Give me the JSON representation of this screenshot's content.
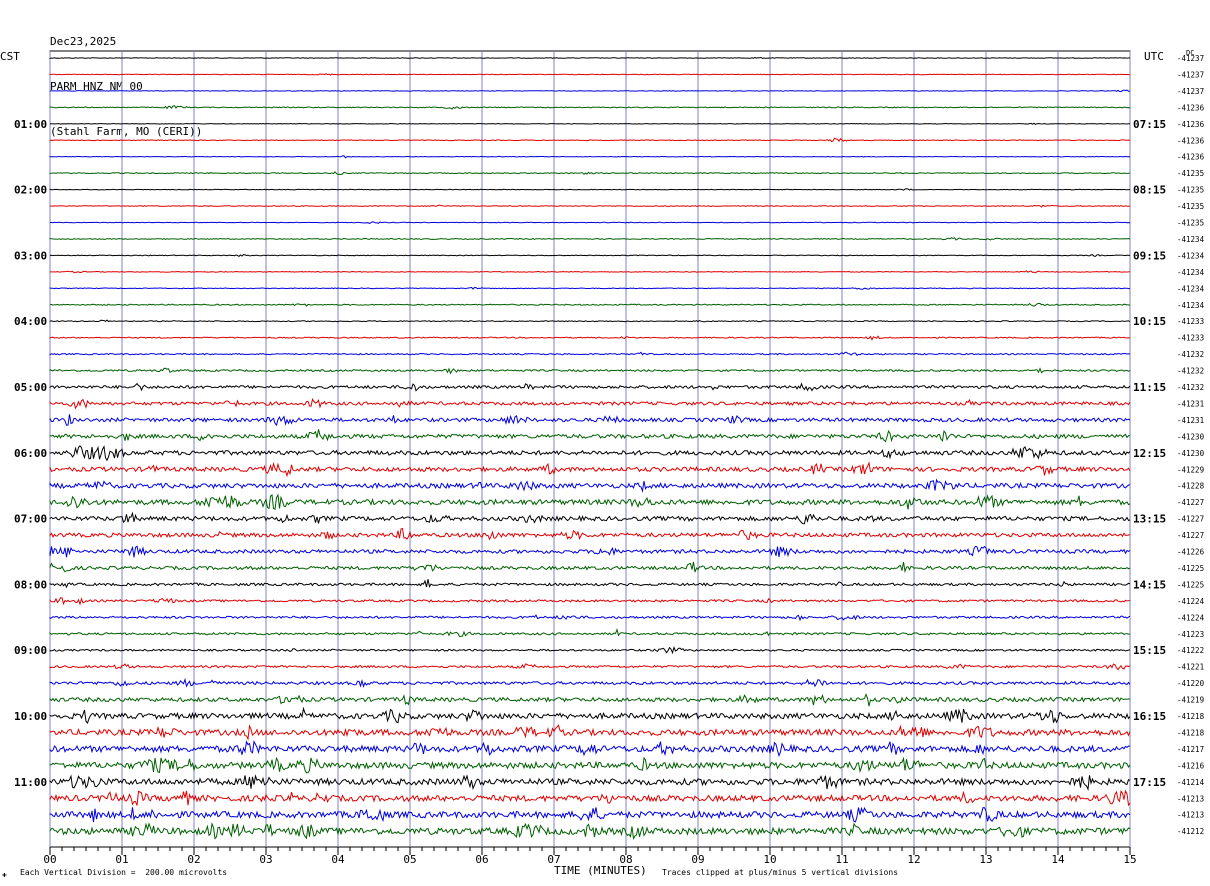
{
  "header": {
    "date": "Dec23,2025",
    "station": "PARM HNZ NM 00",
    "location": "(Stahl Farm, MO (CERI))"
  },
  "left_tz": "CST",
  "right_tz": "UTC",
  "dc_label": "DC",
  "footer": {
    "scale_note": "Each Vertical Division =  200.00 microvolts",
    "clip_note": "Traces clipped at plus/minus 5 vertical divisions",
    "mark": "✚"
  },
  "colors": {
    "trace_cycle": [
      "#000000",
      "#e00000",
      "#0000e0",
      "#006000"
    ],
    "grid": "#8080c0"
  },
  "chart_data": {
    "type": "line",
    "title": "PARM HNZ NM 00",
    "xlabel": "TIME (MINUTES)",
    "ylabel": "",
    "xlim": [
      0,
      15
    ],
    "x_ticks": [
      "00",
      "01",
      "02",
      "03",
      "04",
      "05",
      "06",
      "07",
      "08",
      "09",
      "10",
      "11",
      "12",
      "13",
      "14",
      "15"
    ],
    "left_time_labels": [
      "01:00",
      "02:00",
      "03:00",
      "04:00",
      "05:00",
      "06:00",
      "07:00",
      "08:00",
      "09:00",
      "10:00",
      "11:00"
    ],
    "right_time_labels": [
      "07:15",
      "08:15",
      "09:15",
      "10:15",
      "11:15",
      "12:15",
      "13:15",
      "14:15",
      "15:15",
      "16:15",
      "17:15"
    ],
    "trace_count": 48,
    "dc_offsets": [
      -41237,
      -41237,
      -41237,
      -41236,
      -41236,
      -41236,
      -41236,
      -41235,
      -41235,
      -41235,
      -41235,
      -41234,
      -41234,
      -41234,
      -41234,
      -41234,
      -41233,
      -41233,
      -41232,
      -41232,
      -41232,
      -41231,
      -41231,
      -41230,
      -41230,
      -41229,
      -41228,
      -41227,
      -41227,
      -41227,
      -41226,
      -41225,
      -41225,
      -41224,
      -41224,
      -41223,
      -41222,
      -41221,
      -41220,
      -41219,
      -41218,
      -41218,
      -41217,
      -41216,
      -41214,
      -41213,
      -41213,
      -41212
    ],
    "noise_level": [
      0.3,
      0.3,
      0.3,
      0.5,
      0.3,
      0.4,
      0.3,
      0.5,
      0.3,
      0.4,
      0.3,
      0.5,
      0.4,
      0.4,
      0.4,
      0.6,
      0.5,
      0.6,
      0.7,
      1.0,
      1.6,
      1.8,
      2.0,
      2.2,
      2.4,
      2.4,
      2.6,
      2.8,
      2.4,
      2.2,
      2.0,
      1.8,
      1.4,
      1.2,
      1.2,
      1.2,
      1.0,
      1.2,
      1.6,
      2.2,
      3.0,
      3.2,
      3.4,
      3.4,
      3.4,
      3.2,
      3.4,
      3.6
    ]
  }
}
